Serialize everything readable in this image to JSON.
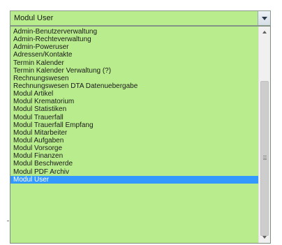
{
  "select": {
    "value": "Modul User",
    "background": "#b8ec8c"
  },
  "dropdown": {
    "options": [
      "Admin-Benutzerverwaltung",
      "Admin-Rechteverwaltung",
      "Admin-Poweruser",
      "Adressen/Kontakte",
      "Termin Kalender",
      "Termin Kalender Verwaltung (?)",
      "Rechnungswesen",
      "Rechnungswesen DTA Datenuebergabe",
      "Modul Artikel",
      "Modul Krematorium",
      "Modul Statistiken",
      "Modul Trauerfall",
      "Modul Trauerfall Empfang",
      "Modul Mitarbeiter",
      "Modul Aufgaben",
      "Modul Vorsorge",
      "Modul Finanzen",
      "Modul Beschwerde",
      "Modul PDF Archiv",
      "Modul User"
    ],
    "selected_option": "Modul User",
    "highlight_color": "#3399ff"
  },
  "scrollbar": {
    "thumb_position": "bottom"
  }
}
